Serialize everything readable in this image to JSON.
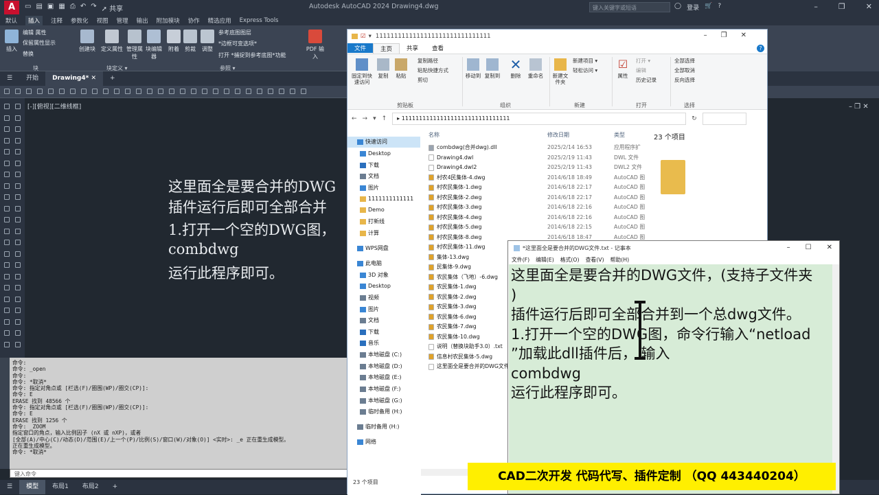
{
  "acad": {
    "title": "Autodesk AutoCAD 2024   Drawing4.dwg",
    "share_label": "共享",
    "search_placeholder": "键入关键字或短语",
    "login_label": "登录",
    "ribbon_tabs": [
      "默认",
      "插入",
      "注释",
      "参数化",
      "视图",
      "管理",
      "输出",
      "附加模块",
      "协作",
      "精选应用",
      "Express Tools"
    ],
    "active_tab": "插入",
    "ribbon": {
      "insert": "插入",
      "edit_attr": "编辑 属性",
      "keep_attr": "保留属性显示",
      "replace": "替换",
      "block_group": "块",
      "create_block": "创建块",
      "define_attr": "定义属性",
      "manage_attr": "管理属性",
      "block_editor": "块编辑器",
      "block_def_group": "块定义 ▾",
      "attach": "附着",
      "clip": "剪裁",
      "adjust": "调整",
      "underlay_layers": "参考底图图层",
      "frames_vary": "*边框可变选项*",
      "snap_underlay": "打开 *捕捉到参考底图*功能",
      "reference_group": "参照 ▾",
      "pdf_import": "PDF 输入"
    },
    "doc_tabs": [
      "开始",
      "Drawing4*"
    ],
    "viewport_label": "[-][俯视][二维线框]",
    "canvas_text": [
      "这里面全是要合并的DWG",
      "插件运行后即可全部合并",
      "1.打开一个空的DWG图，",
      "combdwg",
      "运行此程序即可。"
    ],
    "command_lines": [
      "命令:",
      "命令: _open",
      "命令:",
      "命令: *取消*",
      "命令: 指定对角点或 [栏选(F)/圈围(WP)/圈交(CP)]:",
      "命令: E",
      "ERASE 找到 48566 个",
      "命令: 指定对角点或 [栏选(F)/圈围(WP)/圈交(CP)]:",
      "命令: E",
      "ERASE 找到 1256 个",
      "命令: _ZOOM",
      "指定窗口的角点，输入比例因子 (nX 或 nXP)，或者",
      "[全部(A)/中心(C)/动态(D)/范围(E)/上一个(P)/比例(S)/窗口(W)/对象(O)] <实时>: _e 正在重生成模型。",
      "正在重生成模型。",
      "命令: *取消*"
    ],
    "command_placeholder": "键入命令",
    "status_tabs": [
      "模型",
      "布局1",
      "布局2"
    ]
  },
  "explorer": {
    "title": "1111111111111111111111111111111",
    "tabs": [
      "文件",
      "主页",
      "共享",
      "查看"
    ],
    "ribbon": {
      "pin": "固定到快速访问",
      "copy": "复制",
      "paste": "粘贴",
      "copy_path": "复制路径",
      "paste_shortcut": "粘贴快捷方式",
      "cut": "剪切",
      "clipboard": "剪贴板",
      "move_to": "移动到",
      "copy_to": "复制到",
      "delete": "删除",
      "rename": "重命名",
      "organize": "组织",
      "new_folder": "新建文件夹",
      "new_item": "新建项目 ▾",
      "easy_access": "轻松访问 ▾",
      "new": "新建",
      "properties": "属性",
      "open": "打开 ▾",
      "edit": "编辑",
      "history": "历史记录",
      "open_group": "打开",
      "select_all": "全部选择",
      "select_none": "全部取消",
      "invert": "反向选择",
      "select_group": "选择"
    },
    "address": "1111111111111111111111111111111",
    "nav": [
      {
        "label": "快速访问",
        "sel": true,
        "color": "#3a86d4"
      },
      {
        "label": "Desktop",
        "sel": false,
        "color": "#3a86d4"
      },
      {
        "label": "下载",
        "sel": false,
        "color": "#2a6fbd"
      },
      {
        "label": "文档",
        "sel": false,
        "color": "#6b7d91"
      },
      {
        "label": "图片",
        "sel": false,
        "color": "#3a86d4"
      },
      {
        "label": "1111111111111",
        "sel": false,
        "color": "#e8b64a"
      },
      {
        "label": "Demo",
        "sel": false,
        "color": "#e8b64a"
      },
      {
        "label": "打新线",
        "sel": false,
        "color": "#e8b64a"
      },
      {
        "label": "计算",
        "sel": false,
        "color": "#e8b64a"
      },
      {
        "label": "WPS网盘",
        "sel": false,
        "color": "#3a86d4"
      },
      {
        "label": "此电脑",
        "sel": false,
        "color": "#3a86d4"
      },
      {
        "label": "3D 对象",
        "sel": false,
        "color": "#3a86d4"
      },
      {
        "label": "Desktop",
        "sel": false,
        "color": "#3a86d4"
      },
      {
        "label": "视频",
        "sel": false,
        "color": "#6b7d91"
      },
      {
        "label": "图片",
        "sel": false,
        "color": "#3a86d4"
      },
      {
        "label": "文档",
        "sel": false,
        "color": "#6b7d91"
      },
      {
        "label": "下载",
        "sel": false,
        "color": "#2a6fbd"
      },
      {
        "label": "音乐",
        "sel": false,
        "color": "#2a6fbd"
      },
      {
        "label": "本地磁盘 (C:)",
        "sel": false,
        "color": "#6b7d91"
      },
      {
        "label": "本地磁盘 (D:)",
        "sel": false,
        "color": "#6b7d91"
      },
      {
        "label": "本地磁盘 (E:)",
        "sel": false,
        "color": "#6b7d91"
      },
      {
        "label": "本地磁盘 (F:)",
        "sel": false,
        "color": "#6b7d91"
      },
      {
        "label": "本地磁盘 (G:)",
        "sel": false,
        "color": "#6b7d91"
      },
      {
        "label": "临时备用 (H:)",
        "sel": false,
        "color": "#6b7d91"
      },
      {
        "label": "临时备用 (H:)",
        "sel": false,
        "color": "#6b7d91"
      },
      {
        "label": "网络",
        "sel": false,
        "color": "#3a86d4"
      }
    ],
    "columns": {
      "name": "名称",
      "date": "修改日期",
      "type": "类型"
    },
    "files": [
      {
        "name": "combdwg(合并dwg).dll",
        "date": "2025/2/14 16:53",
        "type": "应用程序扩",
        "color": "#9aa4b0"
      },
      {
        "name": "Drawing4.dwl",
        "date": "2025/2/19 11:43",
        "type": "DWL 文件",
        "color": "#ffffff"
      },
      {
        "name": "Drawing4.dwl2",
        "date": "2025/2/19 11:43",
        "type": "DWL2 文件",
        "color": "#ffffff"
      },
      {
        "name": "村农4民集体-4.dwg",
        "date": "2014/6/18 18:49",
        "type": "AutoCAD 图",
        "color": "#e0a22a"
      },
      {
        "name": "村农民集体-1.dwg",
        "date": "2014/6/18 22:17",
        "type": "AutoCAD 图",
        "color": "#e0a22a"
      },
      {
        "name": "村农民集体-2.dwg",
        "date": "2014/6/18 22:17",
        "type": "AutoCAD 图",
        "color": "#e0a22a"
      },
      {
        "name": "村农民集体-3.dwg",
        "date": "2014/6/18 22:16",
        "type": "AutoCAD 图",
        "color": "#e0a22a"
      },
      {
        "name": "村农民集体-4.dwg",
        "date": "2014/6/18 22:16",
        "type": "AutoCAD 图",
        "color": "#e0a22a"
      },
      {
        "name": "村农民集体-5.dwg",
        "date": "2014/6/18 22:15",
        "type": "AutoCAD 图",
        "color": "#e0a22a"
      },
      {
        "name": "村农民集体-8.dwg",
        "date": "2014/6/18 18:47",
        "type": "AutoCAD 图",
        "color": "#e0a22a"
      },
      {
        "name": "村农民集体-11.dwg",
        "date": "",
        "type": "",
        "color": "#e0a22a"
      },
      {
        "name": "集体-13.dwg",
        "date": "",
        "type": "",
        "color": "#e0a22a"
      },
      {
        "name": "民集体-9.dwg",
        "date": "",
        "type": "",
        "color": "#e0a22a"
      },
      {
        "name": "农民集体（飞地）-6.dwg",
        "date": "",
        "type": "",
        "color": "#e0a22a"
      },
      {
        "name": "农民集体-1.dwg",
        "date": "",
        "type": "",
        "color": "#e0a22a"
      },
      {
        "name": "农民集体-2.dwg",
        "date": "",
        "type": "",
        "color": "#e0a22a"
      },
      {
        "name": "农民集体-3.dwg",
        "date": "",
        "type": "",
        "color": "#e0a22a"
      },
      {
        "name": "农民集体-6.dwg",
        "date": "",
        "type": "",
        "color": "#e0a22a"
      },
      {
        "name": "农民集体-7.dwg",
        "date": "",
        "type": "",
        "color": "#e0a22a"
      },
      {
        "name": "农民集体-10.dwg",
        "date": "",
        "type": "",
        "color": "#e0a22a"
      },
      {
        "name": "说明（替换块助手3.0）.txt",
        "date": "",
        "type": "",
        "color": "#ffffff"
      },
      {
        "name": "信息村农民集体-5.dwg",
        "date": "",
        "type": "",
        "color": "#e0a22a"
      },
      {
        "name": "这里面全是要合并的DWG文件",
        "date": "",
        "type": "",
        "color": "#ffffff"
      }
    ],
    "item_count": "23 个项目",
    "status": "23 个项目"
  },
  "notepad": {
    "title": "*这里面全是要合并的DWG文件.txt - 记事本",
    "menu": [
      "文件(F)",
      "编辑(E)",
      "格式(O)",
      "查看(V)",
      "帮助(H)"
    ],
    "lines": [
      "这里面全是要合并的DWG文件，(支持子文件夹",
      ")",
      "插件运行后即可全部合并到一个总dwg文件。",
      "1.打开一个空的DWG图，命令行输入“netload",
      "”加载此dll插件后，   输入",
      "combdwg",
      "运行此程序即可。"
    ]
  },
  "banner": "CAD二次开发  代码代写、插件定制  （QQ 443440204）"
}
